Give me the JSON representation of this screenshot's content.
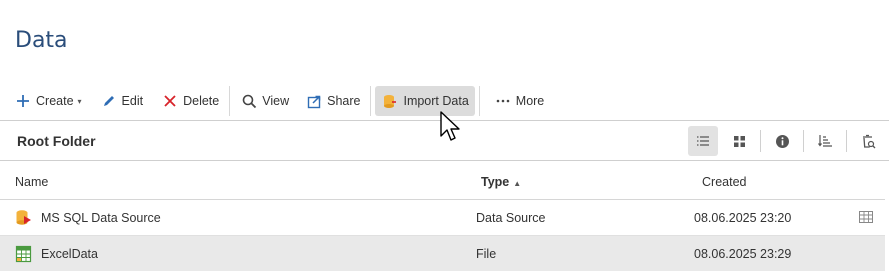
{
  "page": {
    "title": "Data"
  },
  "toolbar": {
    "create_label": "Create",
    "edit_label": "Edit",
    "delete_label": "Delete",
    "view_label": "View",
    "share_label": "Share",
    "import_label": "Import Data",
    "more_label": "More"
  },
  "folder": {
    "title": "Root Folder"
  },
  "table": {
    "headers": {
      "name": "Name",
      "type": "Type",
      "created": "Created"
    },
    "sort_column": "Type",
    "rows": [
      {
        "name": "MS SQL Data Source",
        "type": "Data Source",
        "created": "08.06.2025 23:20",
        "icon": "database-icon"
      },
      {
        "name": "ExcelData",
        "type": "File",
        "created": "08.06.2025 23:29",
        "icon": "spreadsheet-icon"
      }
    ]
  },
  "colors": {
    "title": "#2a4d7a",
    "accent_blue": "#2f6db5",
    "delete_red": "#d8232a",
    "active_button": "#dcdcdc",
    "selected_row": "#e9e9e9"
  }
}
